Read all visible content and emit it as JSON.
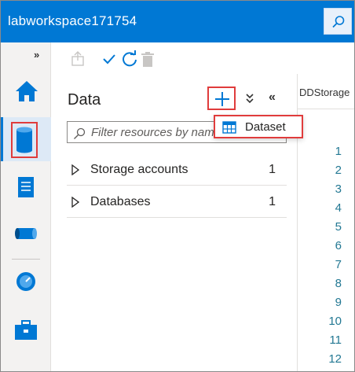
{
  "header": {
    "workspace_title": "labworkspace171754",
    "search_icon": "search-icon"
  },
  "leftnav": {
    "expand_label": "»",
    "items": [
      {
        "name": "home",
        "icon": "home-icon"
      },
      {
        "name": "data",
        "icon": "database-icon",
        "active": true
      },
      {
        "name": "develop",
        "icon": "document-icon"
      },
      {
        "name": "integrate",
        "icon": "pipeline-icon"
      },
      {
        "name": "monitor",
        "icon": "monitor-gauge-icon"
      },
      {
        "name": "manage",
        "icon": "toolbox-icon"
      }
    ]
  },
  "toolbar": {
    "publish_icon": "publish-icon",
    "validate_icon": "checkmark-icon",
    "refresh_icon": "refresh-icon",
    "discard_icon": "trash-icon"
  },
  "data_panel": {
    "title": "Data",
    "add_icon": "plus-icon",
    "collapse_all_label": "⌄⌄",
    "close_panel_label": "«",
    "filter_placeholder": "Filter resources by name",
    "tree": [
      {
        "label": "Storage accounts",
        "count": "1"
      },
      {
        "label": "Databases",
        "count": "1"
      }
    ]
  },
  "dropdown": {
    "items": [
      {
        "label": "Dataset",
        "icon": "table-icon"
      }
    ]
  },
  "editor": {
    "tab_name": "DDStorage",
    "line_numbers": [
      "1",
      "2",
      "3",
      "4",
      "5",
      "6",
      "7",
      "8",
      "9",
      "10",
      "11",
      "12"
    ]
  },
  "colors": {
    "brand_blue": "#0078d4",
    "highlight_red": "#e03c3c",
    "line_number": "#237893"
  }
}
